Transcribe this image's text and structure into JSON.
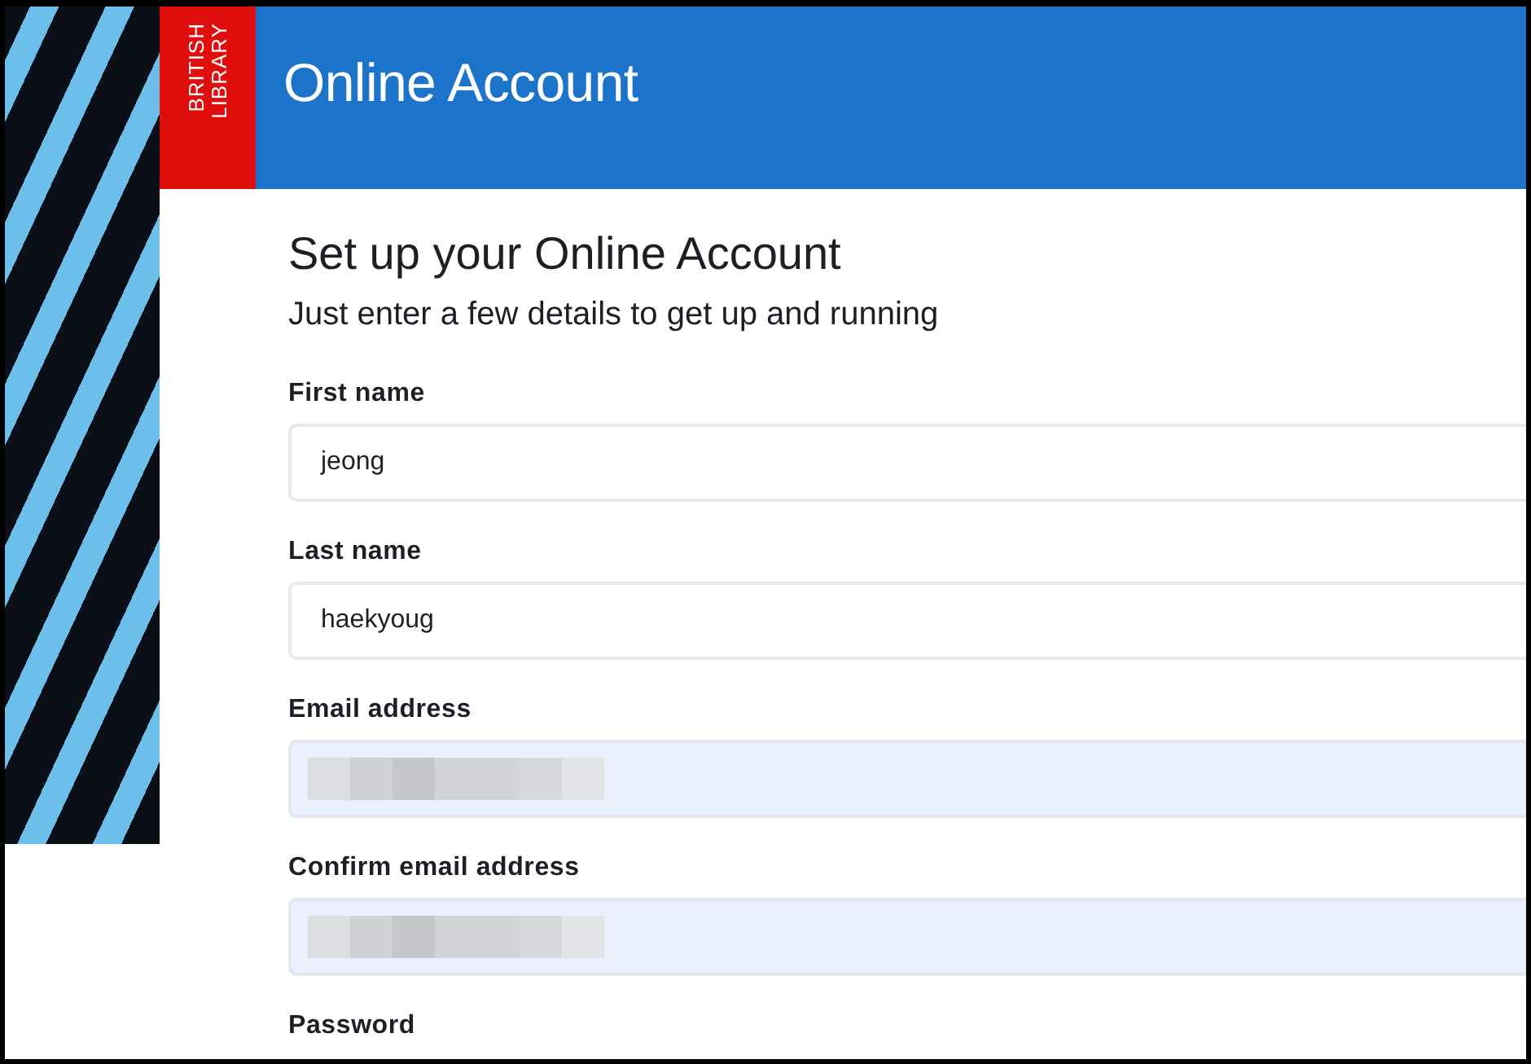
{
  "logo": {
    "lines": [
      "BRITISH",
      "LIBRARY"
    ]
  },
  "header": {
    "title": "Online Account"
  },
  "form": {
    "title": "Set up your Online Account",
    "subtitle": "Just enter a few details to get up and running",
    "fields": [
      {
        "label": "First name",
        "kind": "text",
        "value": "jeong",
        "autofilled": false
      },
      {
        "label": "Last name",
        "kind": "text",
        "value": "haekyoug",
        "autofilled": false
      },
      {
        "label": "Email address",
        "kind": "redacted",
        "autofilled": true
      },
      {
        "label": "Confirm email address",
        "kind": "redacted",
        "autofilled": true
      },
      {
        "label": "Password"
      }
    ]
  }
}
